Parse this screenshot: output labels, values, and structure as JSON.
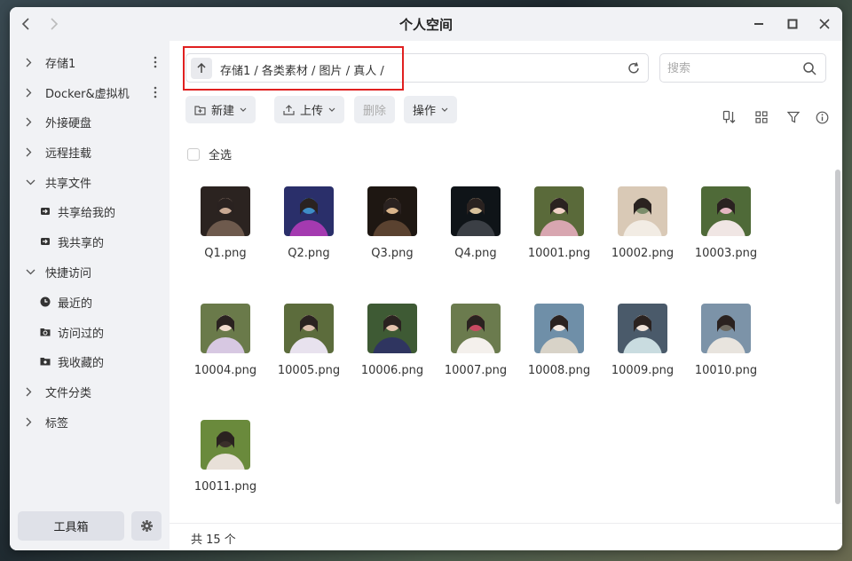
{
  "window": {
    "title": "个人空间"
  },
  "sidebar": {
    "items": [
      {
        "label": "存储1",
        "type": "group",
        "expanded": false,
        "has_menu": true
      },
      {
        "label": "Docker&虚拟机",
        "type": "group",
        "expanded": false,
        "has_menu": true
      },
      {
        "label": "外接硬盘",
        "type": "group",
        "expanded": false
      },
      {
        "label": "远程挂载",
        "type": "group",
        "expanded": false
      },
      {
        "label": "共享文件",
        "type": "group",
        "expanded": true
      },
      {
        "label": "共享给我的",
        "type": "child",
        "icon": "share-in-icon"
      },
      {
        "label": "我共享的",
        "type": "child",
        "icon": "share-out-icon"
      },
      {
        "label": "快捷访问",
        "type": "group",
        "expanded": true
      },
      {
        "label": "最近的",
        "type": "child",
        "icon": "clock-icon"
      },
      {
        "label": "访问过的",
        "type": "child",
        "icon": "folder-history-icon"
      },
      {
        "label": "我收藏的",
        "type": "child",
        "icon": "folder-star-icon"
      },
      {
        "label": "文件分类",
        "type": "group",
        "expanded": false
      },
      {
        "label": "标签",
        "type": "group",
        "expanded": false
      }
    ],
    "toolbox_label": "工具箱"
  },
  "pathbar": {
    "path": "存储1 / 各类素材 / 图片 / 真人 /"
  },
  "search": {
    "placeholder": "搜索"
  },
  "toolbar": {
    "new_label": "新建",
    "upload_label": "上传",
    "delete_label": "删除",
    "actions_label": "操作"
  },
  "select_all_label": "全选",
  "files": [
    {
      "name": "Q1.png"
    },
    {
      "name": "Q2.png"
    },
    {
      "name": "Q3.png"
    },
    {
      "name": "Q4.png"
    },
    {
      "name": "10001.png"
    },
    {
      "name": "10002.png"
    },
    {
      "name": "10003.png"
    },
    {
      "name": "10004.png"
    },
    {
      "name": "10005.png"
    },
    {
      "name": "10006.png"
    },
    {
      "name": "10007.png"
    },
    {
      "name": "10008.png"
    },
    {
      "name": "10009.png"
    },
    {
      "name": "10010.png"
    },
    {
      "name": "10011.png"
    }
  ],
  "footer": {
    "count_text": "共 15 个"
  },
  "colors": {
    "highlight_box": "#e02020",
    "sidebar_bg": "#f1f2f5"
  }
}
